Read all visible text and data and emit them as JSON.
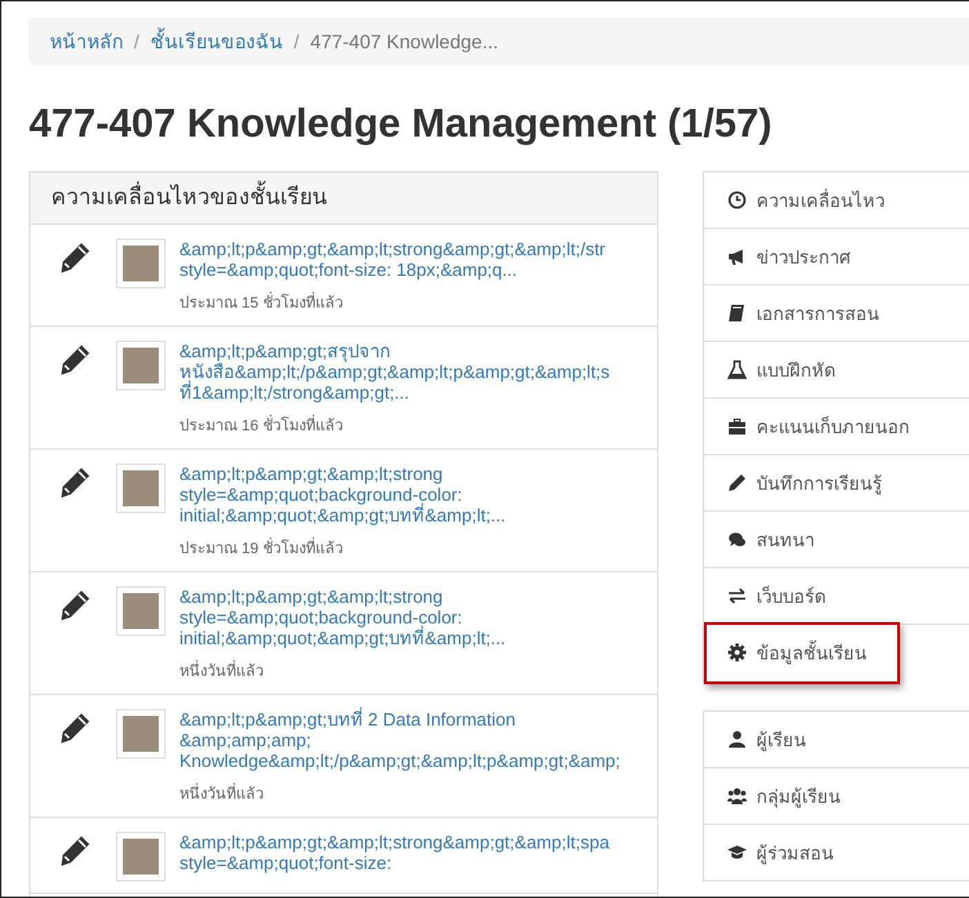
{
  "breadcrumb": [
    {
      "label": "หน้าหลัก",
      "current": false
    },
    {
      "separator": "/",
      "label": "ชั้นเรียนของฉัน",
      "current": false
    },
    {
      "separator": "/",
      "label": "477-407 Knowledge...",
      "current": true
    }
  ],
  "title": "477-407 Knowledge Management (1/57)",
  "activity": {
    "title": "ความเคลื่อนไหวของชั้นเรียน",
    "items": [
      {
        "lines": [
          "&amp;lt;p&amp;gt;&amp;lt;strong&amp;gt;&amp;lt;/str",
          "style=&amp;quot;font-size: 18px;&amp;q..."
        ],
        "time": "ประมาณ 15 ชั่วโมงที่แล้ว"
      },
      {
        "lines": [
          "&amp;lt;p&amp;gt;สรุปจาก",
          "หนังสือ&amp;lt;/p&amp;gt;&amp;lt;p&amp;gt;&amp;lt;s",
          "ที่1&amp;lt;/strong&amp;gt;..."
        ],
        "time": "ประมาณ 16 ชั่วโมงที่แล้ว"
      },
      {
        "lines": [
          "&amp;lt;p&amp;gt;&amp;lt;strong",
          "style=&amp;quot;background-color:",
          "initial;&amp;quot;&amp;gt;บทที่&amp;lt;..."
        ],
        "time": "ประมาณ 19 ชั่วโมงที่แล้ว"
      },
      {
        "lines": [
          "&amp;lt;p&amp;gt;&amp;lt;strong",
          "style=&amp;quot;background-color:",
          "initial;&amp;quot;&amp;gt;บทที่&amp;lt;..."
        ],
        "time": "หนึ่งวันที่แล้ว"
      },
      {
        "lines": [
          "&amp;lt;p&amp;gt;บทที่ 2 Data Information",
          "&amp;amp;amp;",
          "Knowledge&amp;lt;/p&amp;gt;&amp;lt;p&amp;gt;&amp;"
        ],
        "time": "หนึ่งวันที่แล้ว"
      },
      {
        "lines": [
          "&amp;lt;p&amp;gt;&amp;lt;strong&amp;gt;&amp;lt;spa",
          "style=&amp;quot;font-size:"
        ]
      }
    ]
  },
  "nav_groups": [
    [
      {
        "label": "ความเคลื่อนไหว",
        "highlighted": false
      },
      {
        "label": "ข่าวประกาศ",
        "highlighted": false
      },
      {
        "label": "เอกสารการสอน",
        "highlighted": false
      },
      {
        "label": "แบบฝึกหัด",
        "highlighted": false
      },
      {
        "label": "คะแนนเก็บภายนอก",
        "highlighted": false
      },
      {
        "label": "บันทึกการเรียนรู้",
        "highlighted": false
      },
      {
        "label": "สนทนา",
        "highlighted": false
      },
      {
        "label": "เว็บบอร์ด",
        "highlighted": false
      },
      {
        "label": "ข้อมูลชั้นเรียน",
        "highlighted": true
      }
    ],
    [
      {
        "label": "ผู้เรียน",
        "highlighted": false
      },
      {
        "label": "กลุ่มผู้เรียน",
        "highlighted": false
      },
      {
        "label": "ผู้ร่วมสอน",
        "highlighted": false
      }
    ]
  ]
}
